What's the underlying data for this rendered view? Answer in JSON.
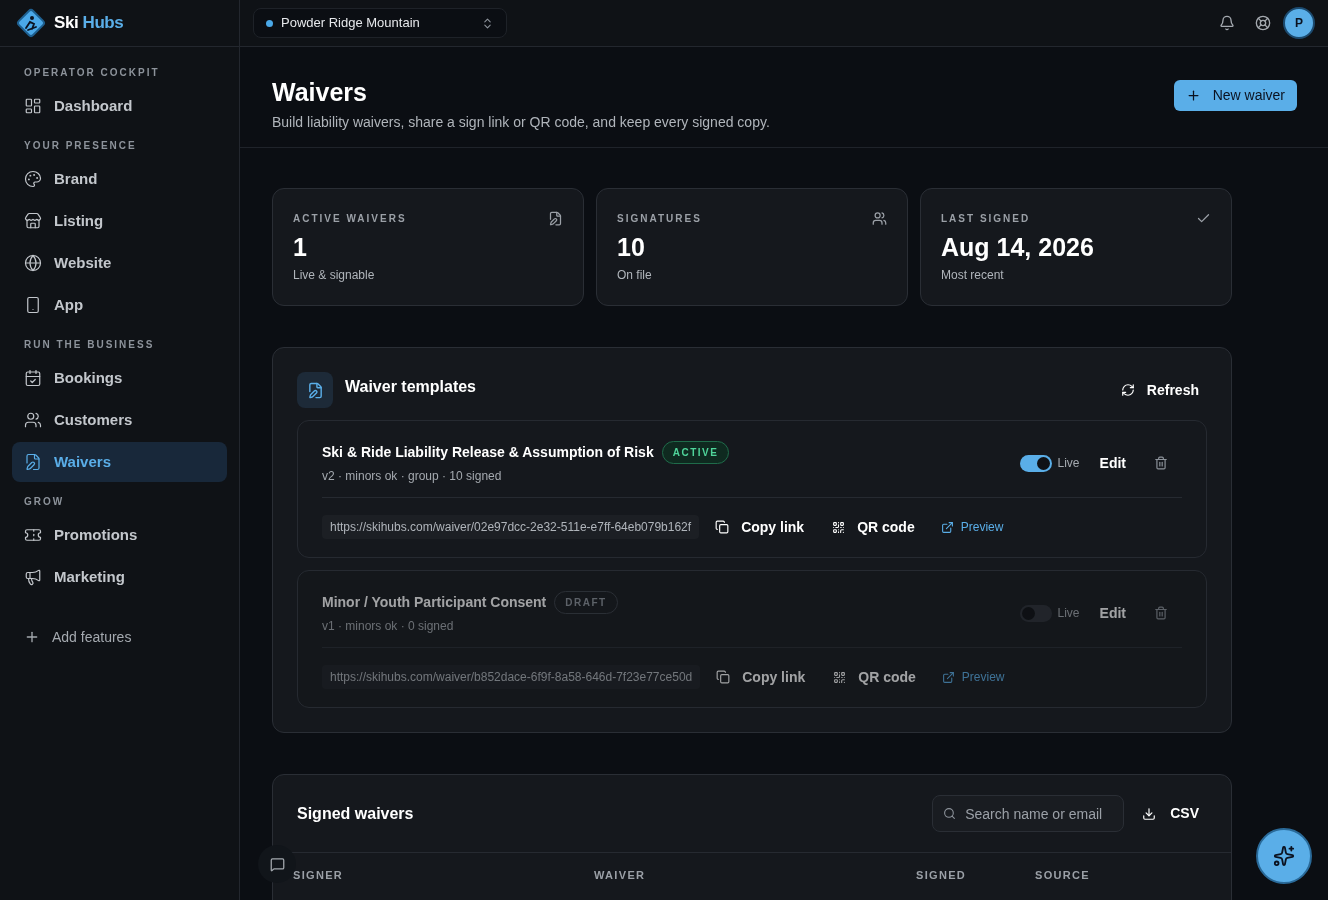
{
  "brand": {
    "name_part_1": "Ski",
    "name_part_2": "Hubs"
  },
  "location_picker": {
    "value": "Powder Ridge Mountain"
  },
  "avatar": {
    "initial": "P"
  },
  "sidebar": {
    "sections": [
      {
        "heading": "OPERATOR COCKPIT",
        "items": [
          {
            "label": "Dashboard",
            "selected": false
          }
        ]
      },
      {
        "heading": "YOUR PRESENCE",
        "items": [
          {
            "label": "Brand",
            "selected": false
          },
          {
            "label": "Listing",
            "selected": false
          },
          {
            "label": "Website",
            "selected": false
          },
          {
            "label": "App",
            "selected": false
          }
        ]
      },
      {
        "heading": "RUN THE BUSINESS",
        "items": [
          {
            "label": "Bookings",
            "selected": false
          },
          {
            "label": "Customers",
            "selected": false
          },
          {
            "label": "Waivers",
            "selected": true
          }
        ]
      },
      {
        "heading": "GROW",
        "items": [
          {
            "label": "Promotions",
            "selected": false
          },
          {
            "label": "Marketing",
            "selected": false
          }
        ]
      }
    ],
    "add_features": "Add features"
  },
  "page": {
    "title": "Waivers",
    "subtitle": "Build liability waivers, share a sign link or QR code, and keep every signed copy.",
    "new_button": "New waiver"
  },
  "stats": [
    {
      "label": "ACTIVE WAIVERS",
      "value": "1",
      "caption": "Live & signable"
    },
    {
      "label": "SIGNATURES",
      "value": "10",
      "caption": "On file"
    },
    {
      "label": "LAST SIGNED",
      "value": "Aug 14, 2026",
      "caption": "Most recent"
    }
  ],
  "templates": {
    "title": "Waiver templates",
    "refresh": "Refresh",
    "items": [
      {
        "name": "Ski & Ride Liability Release & Assumption of Risk",
        "badge": {
          "label": "ACTIVE",
          "kind": "active"
        },
        "meta": "v2 · minors ok · group · 10 signed",
        "live": true,
        "live_label": "Live",
        "edit": "Edit",
        "url": "https://skihubs.com/waiver/02e97dcc-2e32-511e-e7ff-64eb079b162f",
        "copy": "Copy link",
        "qr": "QR code",
        "preview": "Preview"
      },
      {
        "name": "Minor / Youth Participant Consent",
        "badge": {
          "label": "DRAFT",
          "kind": "draft"
        },
        "meta": "v1 · minors ok · 0 signed",
        "live": false,
        "live_label": "Live",
        "edit": "Edit",
        "url": "https://skihubs.com/waiver/b852dace-6f9f-8a58-646d-7f23e77ce50d",
        "copy": "Copy link",
        "qr": "QR code",
        "preview": "Preview"
      }
    ]
  },
  "signed": {
    "title": "Signed waivers",
    "search_placeholder": "Search name or email",
    "csv": "CSV",
    "columns": [
      "SIGNER",
      "WAIVER",
      "SIGNED",
      "SOURCE"
    ]
  }
}
